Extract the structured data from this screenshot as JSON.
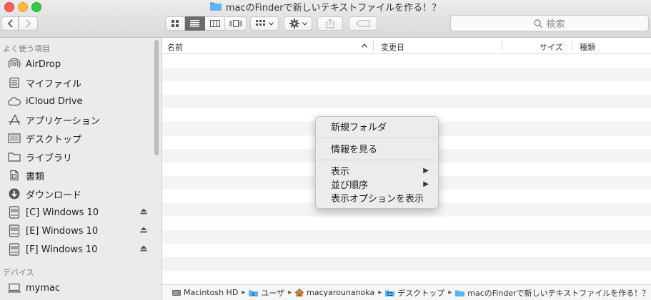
{
  "window": {
    "title": "macのFinderで新しいテキストファイルを作る！？"
  },
  "toolbar": {
    "back_icon": "chevron-left-icon",
    "forward_icon": "chevron-right-icon",
    "views": [
      "icon-view",
      "list-view",
      "column-view",
      "coverflow-view"
    ],
    "active_view": "list-view",
    "search_placeholder": "検索"
  },
  "sidebar": {
    "favorites_header": "よく使う項目",
    "favorites": [
      {
        "label": "AirDrop",
        "icon": "airdrop-icon"
      },
      {
        "label": "マイファイル",
        "icon": "all-my-files-icon"
      },
      {
        "label": "iCloud Drive",
        "icon": "cloud-icon"
      },
      {
        "label": "アプリケーション",
        "icon": "applications-icon"
      },
      {
        "label": "デスクトップ",
        "icon": "desktop-icon"
      },
      {
        "label": "ライブラリ",
        "icon": "folder-icon"
      },
      {
        "label": "書類",
        "icon": "documents-icon"
      },
      {
        "label": "ダウンロード",
        "icon": "download-icon"
      },
      {
        "label": "[C] Windows 10",
        "icon": "drive-icon",
        "eject": true
      },
      {
        "label": "[E] Windows 10",
        "icon": "drive-icon",
        "eject": true
      },
      {
        "label": "[F] Windows 10",
        "icon": "drive-icon",
        "eject": true
      }
    ],
    "devices_header": "デバイス",
    "devices": [
      {
        "label": "mymac",
        "icon": "laptop-icon"
      }
    ]
  },
  "columns": {
    "name": "名前",
    "modified": "変更日",
    "size": "サイズ",
    "kind": "種類"
  },
  "context_menu": {
    "items": [
      "新規フォルダ",
      "情報を見る",
      "表示",
      "並び順序",
      "表示オプションを表示"
    ]
  },
  "pathbar": {
    "crumbs": [
      {
        "label": "Macintosh HD",
        "icon": "hard-disk-icon"
      },
      {
        "label": "ユーザ",
        "icon": "users-folder-icon"
      },
      {
        "label": "macyarounanoka",
        "icon": "home-icon"
      },
      {
        "label": "デスクトップ",
        "icon": "desktop-folder-icon"
      },
      {
        "label": "macのFinderで新しいテキストファイルを作る！？",
        "icon": "folder-icon"
      }
    ]
  },
  "colors": {
    "folder_blue": "#5fb2ec",
    "sidebar_bg": "#ebebeb",
    "row_stripe": "#f4f4f4"
  }
}
